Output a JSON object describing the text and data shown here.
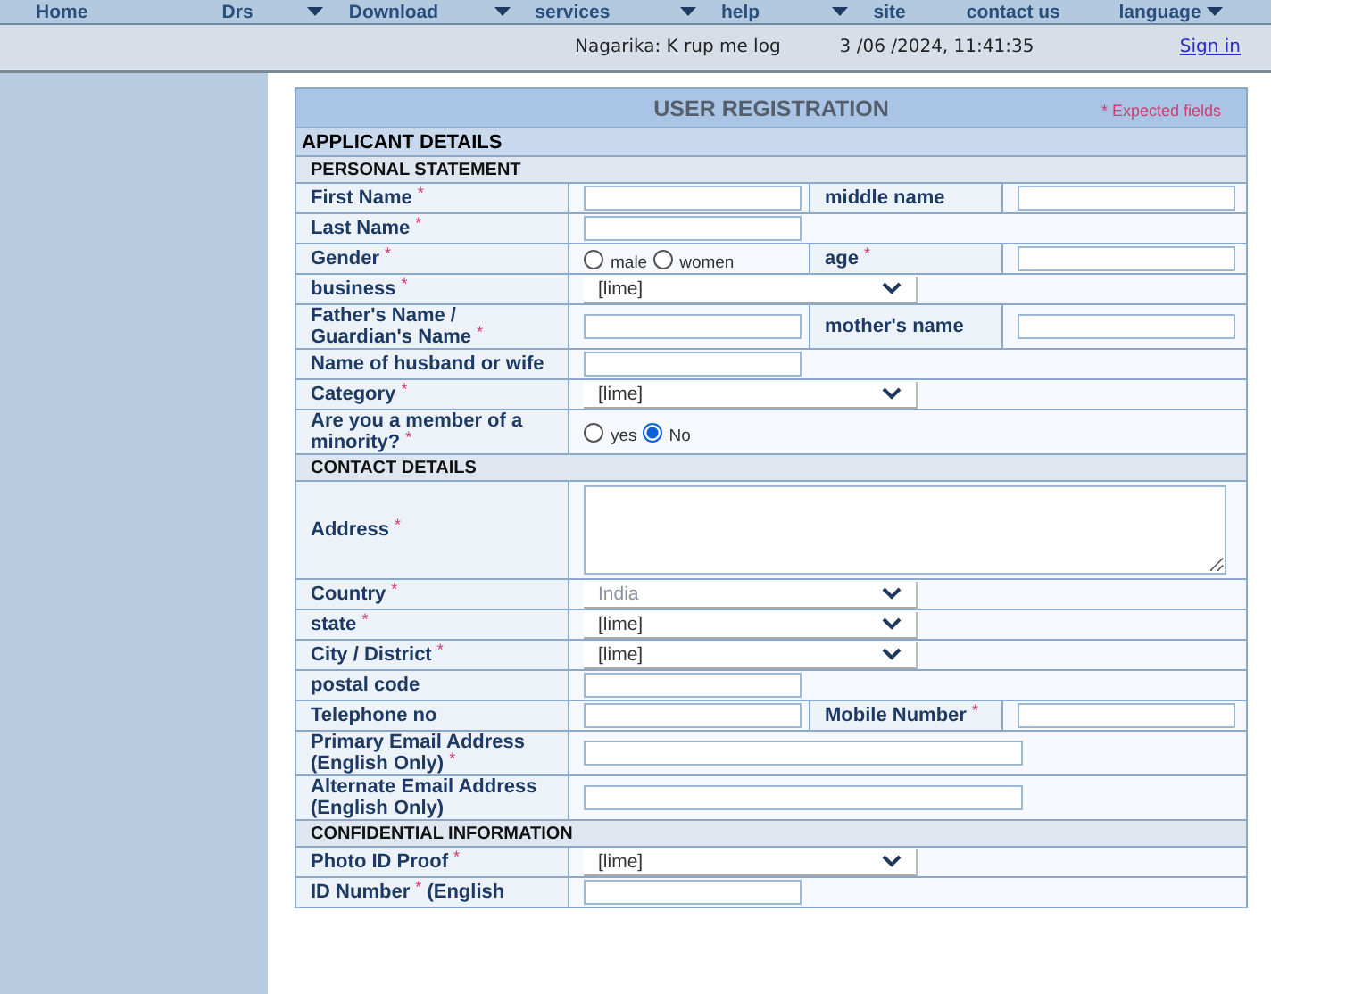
{
  "nav": [
    {
      "label": "Home",
      "dropdown": false
    },
    {
      "label": "Drs",
      "dropdown": true
    },
    {
      "label": "Download",
      "dropdown": true
    },
    {
      "label": "services",
      "dropdown": true
    },
    {
      "label": "help",
      "dropdown": true
    },
    {
      "label": "site",
      "dropdown": false
    },
    {
      "label": "contact us",
      "dropdown": false
    },
    {
      "label": "language",
      "dropdown": true
    }
  ],
  "status": {
    "user": "Nagarika: K rup me log",
    "datetime": "3 /06 /2024, 11:41:35",
    "link": "Sign in"
  },
  "form": {
    "title": "USER REGISTRATION",
    "legend_mark": "*",
    "legend": "Expected fields",
    "section": "APPLICANT DETAILS",
    "groups": [
      {
        "title": "PERSONAL STATEMENT",
        "rows": [
          {
            "label": "First Name",
            "mark": "*",
            "kind": "text",
            "extra": {
              "label": "middle name",
              "kind": "text"
            }
          },
          {
            "label": "Last Name",
            "mark": "*",
            "kind": "text"
          },
          {
            "label": "Gender",
            "mark": "*",
            "kind": "radio",
            "options": [
              {
                "label": "male",
                "selected": false
              },
              {
                "label": "women",
                "selected": false
              }
            ],
            "extra": {
              "label": "age",
              "mark": "*",
              "kind": "text"
            }
          },
          {
            "label": "business",
            "mark": "*",
            "kind": "select",
            "value": "[lime]",
            "disabled": false
          },
          {
            "label": "Father's Name / Guardian's Name",
            "mark": "*",
            "kind": "text",
            "extra": {
              "label": "mother's name",
              "kind": "text"
            }
          },
          {
            "label": "Name of husband or wife",
            "kind": "text"
          },
          {
            "label": "Category",
            "mark": "*",
            "kind": "select",
            "value": "[lime]",
            "disabled": false
          },
          {
            "label": "Are you a member of a minority?",
            "mark": "*",
            "kind": "radio",
            "options": [
              {
                "label": "yes",
                "selected": false
              },
              {
                "label": "No",
                "selected": true
              }
            ]
          }
        ]
      },
      {
        "title": "CONTACT DETAILS",
        "rows": [
          {
            "label": "Address",
            "mark": "*",
            "kind": "textarea"
          },
          {
            "label": "Country",
            "mark": "*",
            "kind": "select",
            "value": "India",
            "disabled": true
          },
          {
            "label": "state",
            "mark": "*",
            "kind": "select",
            "value": "[lime]",
            "disabled": false
          },
          {
            "label": "City / District",
            "mark": "*",
            "kind": "select",
            "value": "[lime]",
            "disabled": false
          },
          {
            "label": "postal code",
            "kind": "text"
          },
          {
            "label": "Telephone no",
            "kind": "text",
            "extra": {
              "label": "Mobile Number",
              "mark": "*",
              "kind": "text"
            }
          },
          {
            "label": "Primary Email Address (English Only)",
            "mark": "*",
            "kind": "wide"
          },
          {
            "label": "Alternate Email Address (English Only)",
            "kind": "wide"
          }
        ]
      },
      {
        "title": "CONFIDENTIAL INFORMATION",
        "rows": [
          {
            "label": "Photo ID Proof",
            "mark": "*",
            "kind": "select",
            "value": "[lime]",
            "disabled": false
          },
          {
            "label": "ID Number",
            "mark": "*",
            "suffix": " (English",
            "kind": "text"
          }
        ]
      }
    ]
  }
}
